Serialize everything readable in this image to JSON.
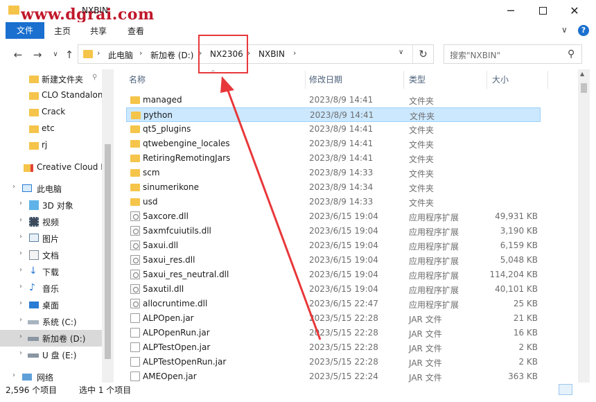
{
  "window": {
    "title": "NXBIN",
    "watermark": "www.dgrai.com",
    "minimize_glyph": "─",
    "close_glyph": "✕"
  },
  "ribbon": {
    "tabs": [
      "文件",
      "主页",
      "共享",
      "查看"
    ],
    "expand_glyph": "∨",
    "help_glyph": "?"
  },
  "nav": {
    "back_glyph": "←",
    "forward_glyph": "→",
    "recent_glyph": "∨",
    "up_glyph": "↑",
    "crumbs": [
      "此电脑",
      "新加卷 (D:)",
      "NX2306",
      "NXBIN"
    ],
    "crumb_sep": "›",
    "dropdown_glyph": "∨",
    "refresh_glyph": "↻",
    "search_placeholder": "搜索\"NXBIN\"",
    "search_glyph": "⚲"
  },
  "sidebar": {
    "quick_access": [
      {
        "label": "新建文件夹",
        "pinned": true
      },
      {
        "label": "CLO Standalon",
        "pinned": false
      },
      {
        "label": "Crack",
        "pinned": false
      },
      {
        "label": "etc",
        "pinned": false
      },
      {
        "label": "rj",
        "pinned": false
      }
    ],
    "creative_cloud": "Creative Cloud F",
    "this_pc": "此电脑",
    "pc_items": [
      "3D 对象",
      "视频",
      "图片",
      "文档",
      "下载",
      "音乐",
      "桌面",
      "系统 (C:)",
      "新加卷 (D:)",
      "U 盘 (E:)"
    ],
    "network": "网络",
    "pin_glyph": "📌",
    "expand_glyph": "›"
  },
  "columns": {
    "name": "名称",
    "date": "修改日期",
    "type": "类型",
    "size": "大小",
    "sort_glyph": "^"
  },
  "files": [
    {
      "name": "managed",
      "date": "2023/8/9 14:41",
      "type": "文件夹",
      "size": "",
      "kind": "folder"
    },
    {
      "name": "python",
      "date": "2023/8/9 14:41",
      "type": "文件夹",
      "size": "",
      "kind": "folder",
      "selected": true
    },
    {
      "name": "qt5_plugins",
      "date": "2023/8/9 14:41",
      "type": "文件夹",
      "size": "",
      "kind": "folder"
    },
    {
      "name": "qtwebengine_locales",
      "date": "2023/8/9 14:41",
      "type": "文件夹",
      "size": "",
      "kind": "folder"
    },
    {
      "name": "RetiringRemotingJars",
      "date": "2023/8/9 14:41",
      "type": "文件夹",
      "size": "",
      "kind": "folder"
    },
    {
      "name": "scm",
      "date": "2023/8/9 14:33",
      "type": "文件夹",
      "size": "",
      "kind": "folder"
    },
    {
      "name": "sinumerikone",
      "date": "2023/8/9 14:34",
      "type": "文件夹",
      "size": "",
      "kind": "folder"
    },
    {
      "name": "usd",
      "date": "2023/8/9 14:33",
      "type": "文件夹",
      "size": "",
      "kind": "folder"
    },
    {
      "name": "5axcore.dll",
      "date": "2023/6/15 19:04",
      "type": "应用程序扩展",
      "size": "49,931 KB",
      "kind": "dll"
    },
    {
      "name": "5axmfcuiutils.dll",
      "date": "2023/6/15 19:04",
      "type": "应用程序扩展",
      "size": "3,190 KB",
      "kind": "dll"
    },
    {
      "name": "5axui.dll",
      "date": "2023/6/15 19:04",
      "type": "应用程序扩展",
      "size": "6,159 KB",
      "kind": "dll"
    },
    {
      "name": "5axui_res.dll",
      "date": "2023/6/15 19:04",
      "type": "应用程序扩展",
      "size": "5,048 KB",
      "kind": "dll"
    },
    {
      "name": "5axui_res_neutral.dll",
      "date": "2023/6/15 19:04",
      "type": "应用程序扩展",
      "size": "114,204 KB",
      "kind": "dll"
    },
    {
      "name": "5axutil.dll",
      "date": "2023/6/15 19:04",
      "type": "应用程序扩展",
      "size": "40,101 KB",
      "kind": "dll"
    },
    {
      "name": "allocruntime.dll",
      "date": "2023/6/15 22:47",
      "type": "应用程序扩展",
      "size": "25 KB",
      "kind": "dll"
    },
    {
      "name": "ALPOpen.jar",
      "date": "2023/5/15 22:28",
      "type": "JAR 文件",
      "size": "21 KB",
      "kind": "jar"
    },
    {
      "name": "ALPOpenRun.jar",
      "date": "2023/5/15 22:28",
      "type": "JAR 文件",
      "size": "16 KB",
      "kind": "jar"
    },
    {
      "name": "ALPTestOpen.jar",
      "date": "2023/5/15 22:28",
      "type": "JAR 文件",
      "size": "2 KB",
      "kind": "jar"
    },
    {
      "name": "ALPTestOpenRun.jar",
      "date": "2023/5/15 22:28",
      "type": "JAR 文件",
      "size": "2 KB",
      "kind": "jar"
    },
    {
      "name": "AMEOpen.jar",
      "date": "2023/5/15 22:24",
      "type": "JAR 文件",
      "size": "363 KB",
      "kind": "jar"
    }
  ],
  "status": {
    "item_count": "2,596 个项目",
    "selected": "选中 1 个项目"
  },
  "colors": {
    "accent": "#1a6fcf",
    "folder": "#f5c44a",
    "selection": "#cce8ff",
    "annotation": "#e8373a"
  }
}
